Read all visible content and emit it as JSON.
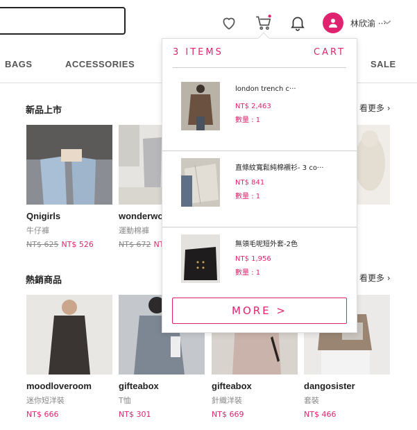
{
  "header": {
    "search": {
      "placeholder": ""
    },
    "icons": [
      "heart-icon",
      "cart-icon",
      "bell-icon",
      "user-icon"
    ],
    "username": "林欣渝 ···",
    "accent": "#e0236f"
  },
  "nav": {
    "items": [
      {
        "label": "BAGS"
      },
      {
        "label": "ACCESSORIES"
      },
      {
        "label": "SALE"
      }
    ]
  },
  "sections": [
    {
      "title": "新品上市",
      "see_more": "看更多 ›",
      "products": [
        {
          "brand": "Qnigirls",
          "category": "牛仔褲",
          "old_price": "NT$ 625",
          "price": "NT$ 526"
        },
        {
          "brand": "wonderwo",
          "category": "運動棉褲",
          "old_price": "NT$ 672",
          "price": "NT$"
        },
        {
          "brand": "",
          "category": "",
          "old_price": "",
          "price": ""
        },
        {
          "brand": "",
          "category": "",
          "old_price": "",
          "price": ""
        }
      ]
    },
    {
      "title": "熱銷商品",
      "see_more": "看更多 ›",
      "products": [
        {
          "brand": "moodloveroom",
          "category": "迷你短洋裝",
          "price": "NT$ 666"
        },
        {
          "brand": "gifteabox",
          "category": "T恤",
          "price": "NT$ 301"
        },
        {
          "brand": "gifteabox",
          "category": "針織洋裝",
          "price": "NT$ 669"
        },
        {
          "brand": "dangosister",
          "category": "套裝",
          "price": "NT$ 466"
        }
      ]
    }
  ],
  "cart_dropdown": {
    "count_label": "3 ITEMS",
    "cart_label": "CART",
    "items": [
      {
        "name": "london trench c···",
        "price": "NT$ 2,463",
        "qty": "數量 : 1"
      },
      {
        "name": "直條紋寬鬆純棉襯衫- 3 co···",
        "price": "NT$ 841",
        "qty": "數量 : 1"
      },
      {
        "name": "無領毛呢短外套-2色",
        "price": "NT$ 1,956",
        "qty": "數量 : 1"
      }
    ],
    "more_label": "MORE >"
  }
}
